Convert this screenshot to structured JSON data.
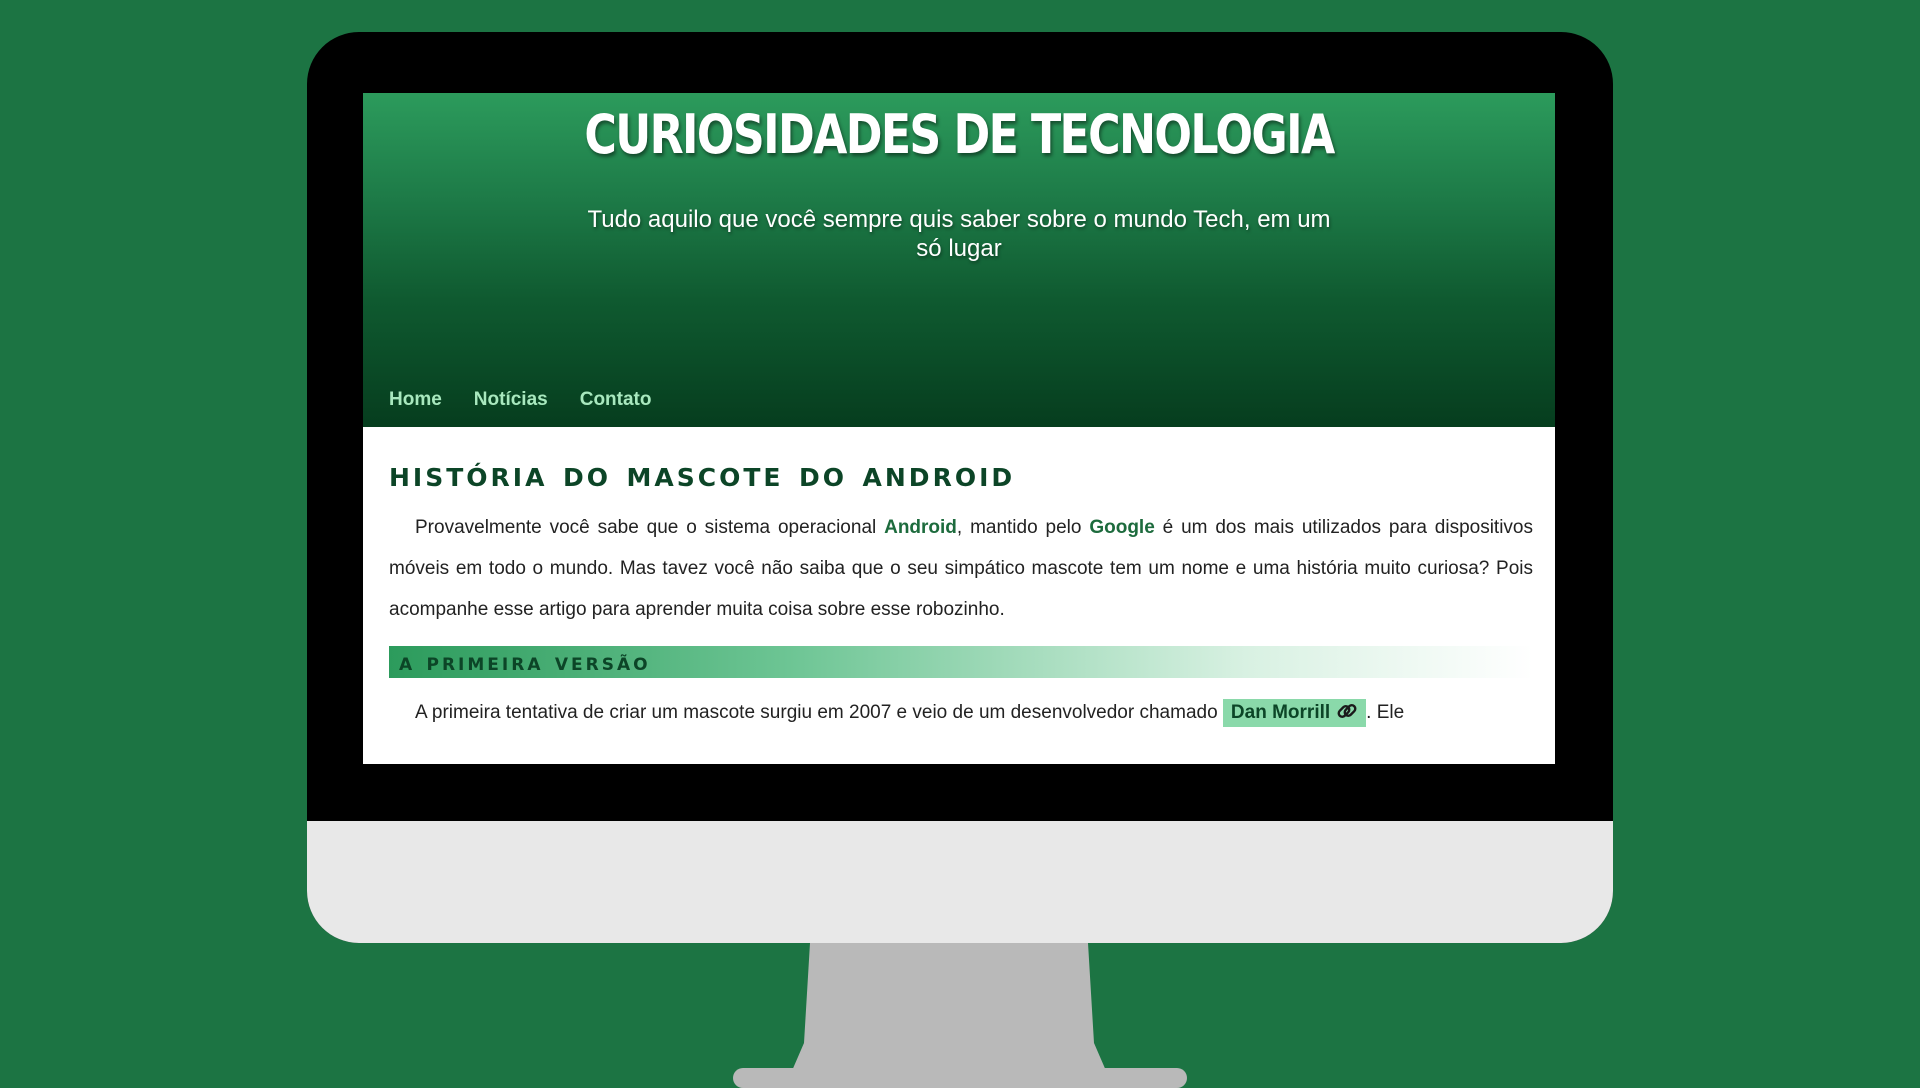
{
  "site": {
    "title": "CURIOSIDADES DE TECNOLOGIA",
    "subtitle": "Tudo aquilo que você sempre quis saber sobre o mundo Tech, em um só lugar"
  },
  "nav": [
    {
      "label": "Home"
    },
    {
      "label": "Notícias"
    },
    {
      "label": "Contato"
    }
  ],
  "article": {
    "title": "HISTÓRIA DO MASCOTE DO ANDROID",
    "intro": {
      "p1": "Provavelmente você sabe que o sistema operacional ",
      "android": "Android",
      "p2": ", mantido pelo ",
      "google": "Google",
      "p3": " é um dos mais utilizados para dispositivos móveis em todo o mundo. Mas tavez você não saiba que o seu simpático mascote tem um nome e uma história muito curiosa? Pois acompanhe esse artigo para aprender muita coisa sobre esse robozinho."
    },
    "section1": {
      "title": "A PRIMEIRA VERSÃO",
      "p1": "A primeira tentativa de criar um mascote surgiu em 2007 e veio de um desenvolvedor chamado ",
      "link": "Dan Morrill",
      "p2": ". Ele"
    }
  },
  "colors": {
    "background": "#1c7443",
    "accent": "#2c9b5c",
    "nav_link": "#a8e8be",
    "link_chip": "#8ad9aa"
  },
  "icons": {
    "external_link": "link-icon"
  }
}
